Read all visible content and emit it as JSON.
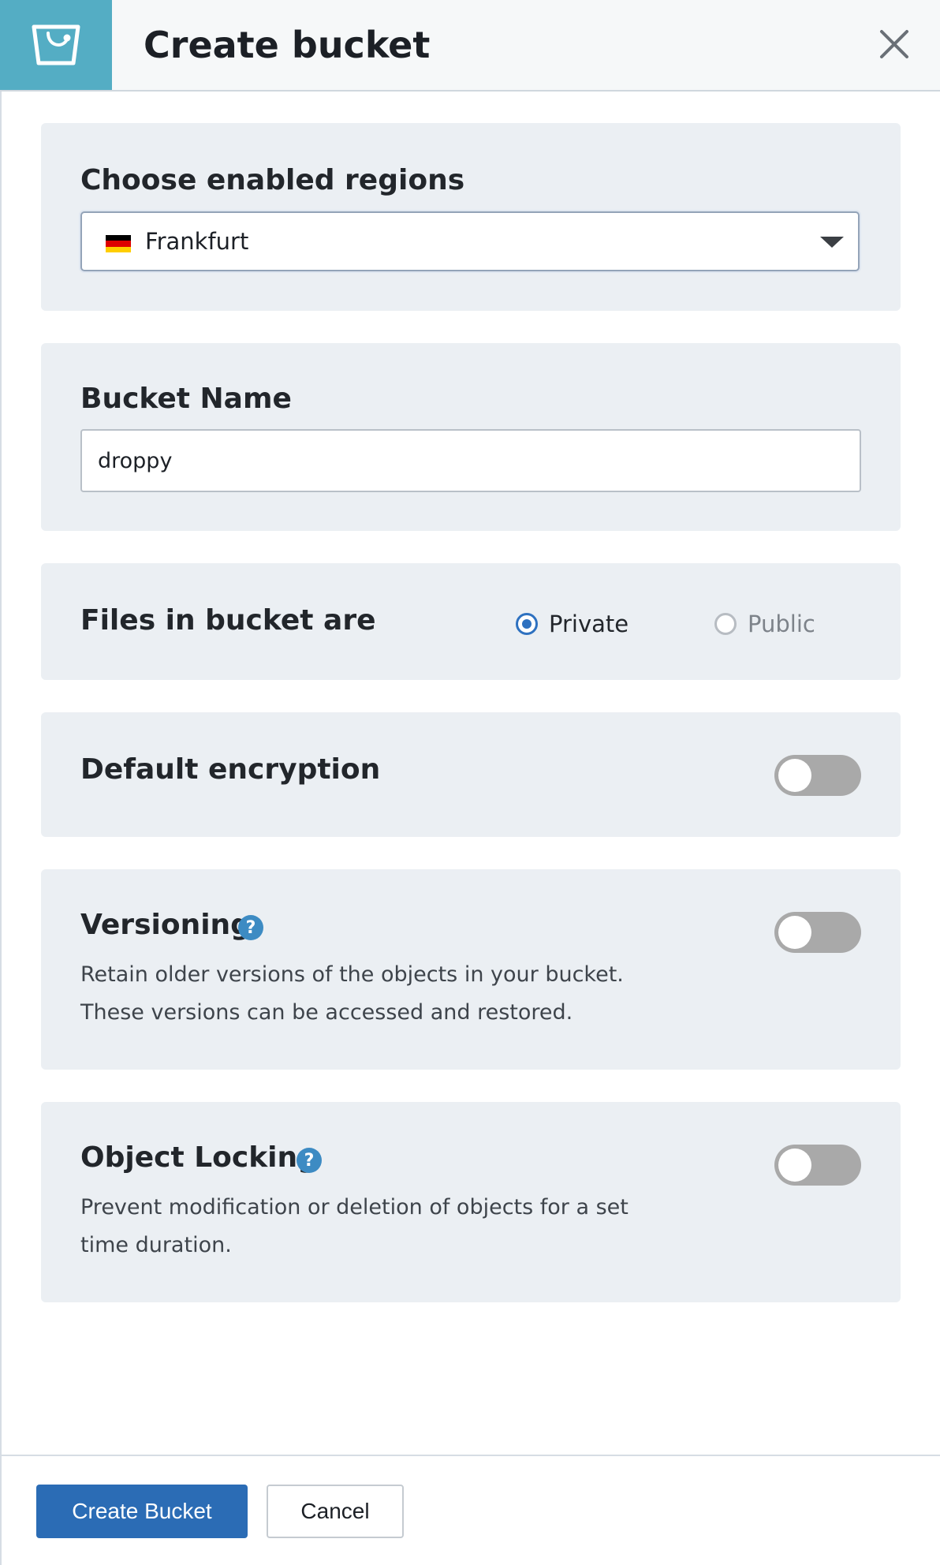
{
  "header": {
    "title": "Create bucket",
    "icon": "bucket-icon",
    "close_icon": "close-icon"
  },
  "region": {
    "label": "Choose enabled regions",
    "selected": "Frankfurt",
    "flag_icon": "germany-flag-icon"
  },
  "bucket_name": {
    "label": "Bucket Name",
    "value": "droppy"
  },
  "visibility": {
    "label": "Files in bucket are",
    "options": [
      {
        "label": "Private",
        "selected": true
      },
      {
        "label": "Public",
        "selected": false
      }
    ]
  },
  "encryption": {
    "label": "Default encryption",
    "enabled": false
  },
  "versioning": {
    "label": "Versioning",
    "help_icon": "help-icon",
    "description_line1": "Retain older versions of the objects in your bucket.",
    "description_line2": "These versions can be accessed and restored.",
    "enabled": false
  },
  "object_locking": {
    "label": "Object Locking",
    "help_icon": "help-icon",
    "description_line1": "Prevent modification or deletion of objects for a set",
    "description_line2": "time duration.",
    "enabled": false
  },
  "footer": {
    "create_label": "Create Bucket",
    "cancel_label": "Cancel"
  },
  "colors": {
    "header_accent": "#54adc4",
    "primary": "#2b6cb5",
    "card_bg": "#ebeff3",
    "radio_active": "#2e71c0",
    "help_icon": "#3d8bc3",
    "toggle_off": "#a9a9a9"
  }
}
